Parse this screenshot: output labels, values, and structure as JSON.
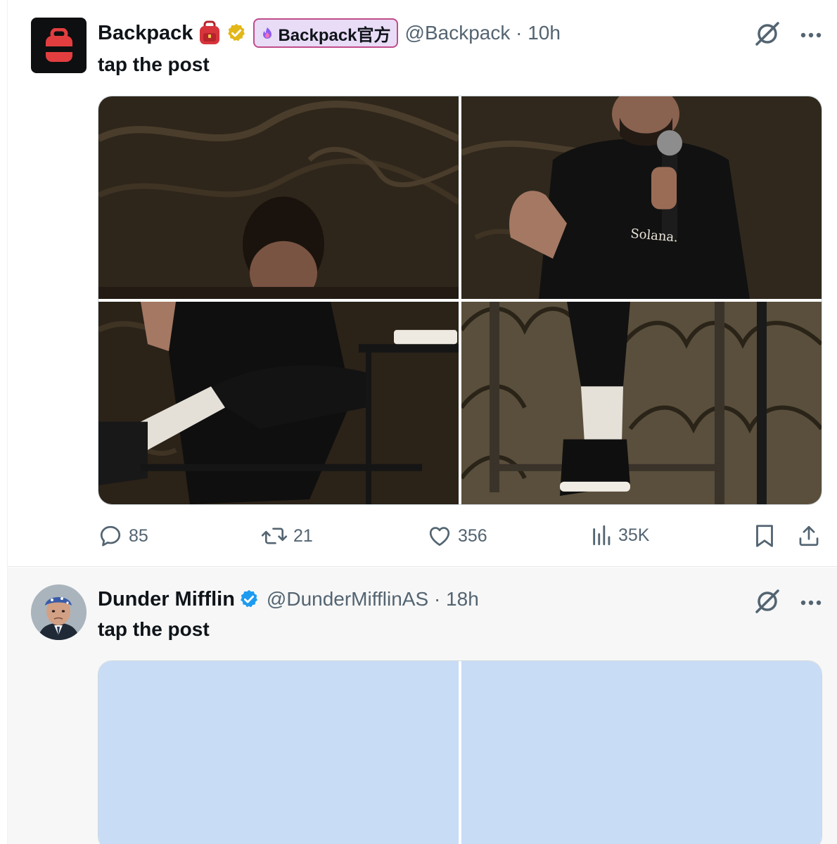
{
  "posts": [
    {
      "name": "Backpack",
      "name_emoji": "backpack-emoji",
      "verified": "gold-check",
      "affiliate": {
        "label": "Backpack官方",
        "icon": "backpack-exchange-icon"
      },
      "handle": "@Backpack",
      "separator": "·",
      "time": "10h",
      "text": "tap the post",
      "media_text": "Solana.",
      "stats": {
        "replies": "85",
        "reposts": "21",
        "likes": "356",
        "views": "35K"
      }
    },
    {
      "name": "Dunder Mifflin",
      "verified": "blue-check",
      "handle": "@DunderMifflinAS",
      "separator": "·",
      "time": "18h",
      "text": "tap the post"
    }
  ],
  "colors": {
    "gold_check": "#e2b719",
    "blue_check": "#1d9bf0",
    "affiliate_border": "#c04c8a",
    "affiliate_bg": "#e9dcf7",
    "muted": "#536471",
    "brand_red": "#e33e3f"
  },
  "icons": [
    "grok-icon",
    "more-icon",
    "reply-icon",
    "repost-icon",
    "like-icon",
    "views-icon",
    "bookmark-icon",
    "share-icon"
  ]
}
